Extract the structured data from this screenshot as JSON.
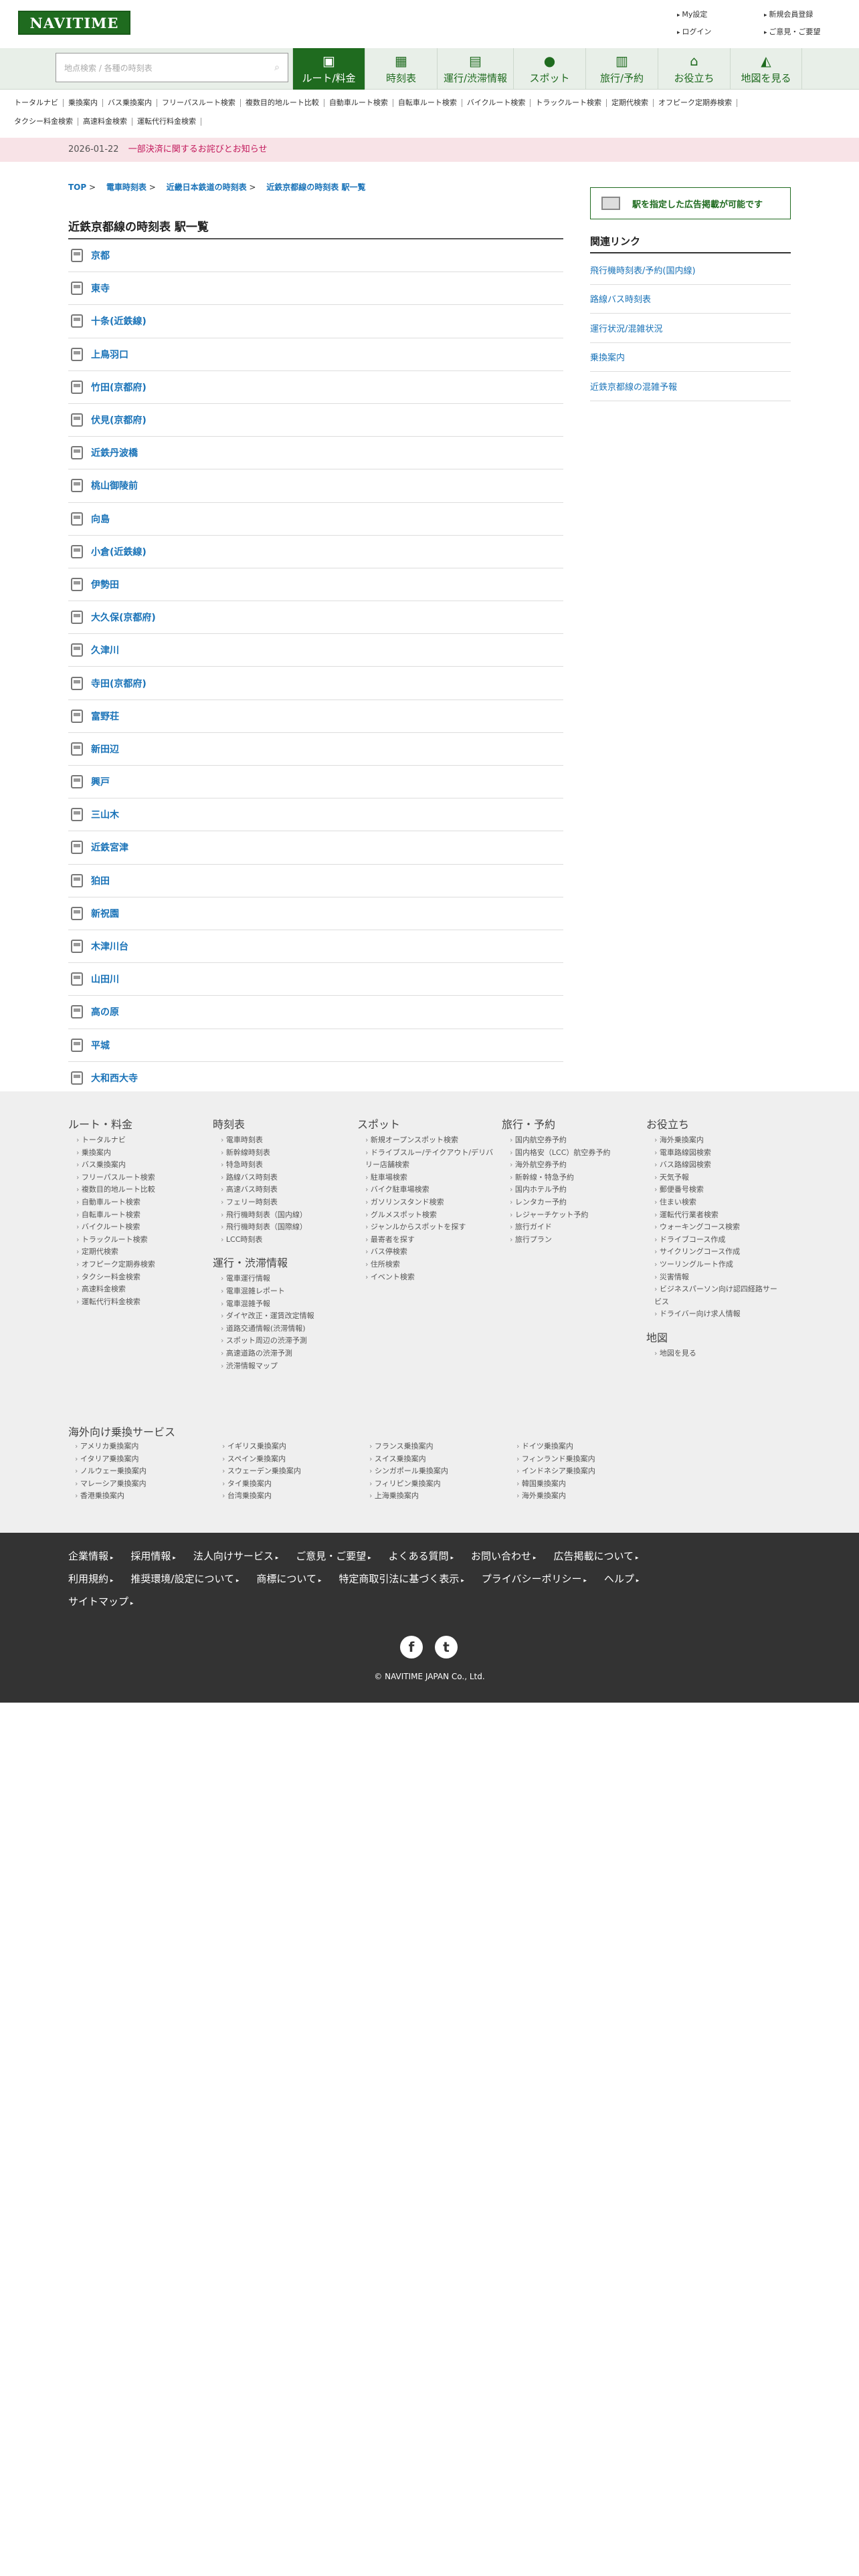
{
  "header": {
    "logo": "NAVITIME",
    "links": [
      "My設定",
      "新規会員登録",
      "ログイン",
      "ご意見・ご要望"
    ]
  },
  "search": {
    "placeholder": "地点検索 / 各種の時刻表"
  },
  "nav": [
    {
      "label": "ルート/料金",
      "icon": "package-icon"
    },
    {
      "label": "時刻表",
      "icon": "calendar-icon"
    },
    {
      "label": "運行/渋滞情報",
      "icon": "bus-train-icon"
    },
    {
      "label": "スポット",
      "icon": "map-pin-icon"
    },
    {
      "label": "旅行/予約",
      "icon": "luggage-icon"
    },
    {
      "label": "お役立ち",
      "icon": "house-icon"
    },
    {
      "label": "地図を見る",
      "icon": "map-icon"
    }
  ],
  "subnav": [
    "トータルナビ",
    "乗換案内",
    "バス乗換案内",
    "フリーパスルート検索",
    "複数目的地ルート比較",
    "自動車ルート検索",
    "自転車ルート検索",
    "バイクルート検索",
    "トラックルート検索",
    "定期代検索",
    "オフピーク定期券検索",
    "タクシー料金検索",
    "高速料金検索",
    "運転代行料金検索"
  ],
  "notice": {
    "date": "2026-01-22",
    "text": "一部決済に関するお詫びとお知らせ"
  },
  "breadcrumb": [
    "TOP",
    "電車時刻表",
    "近畿日本鉄道の時刻表",
    "近鉄京都線の時刻表 駅一覧"
  ],
  "page_title": "近鉄京都線の時刻表 駅一覧",
  "stations": [
    "京都",
    "東寺",
    "十条(近鉄線)",
    "上鳥羽口",
    "竹田(京都府)",
    "伏見(京都府)",
    "近鉄丹波橋",
    "桃山御陵前",
    "向島",
    "小倉(近鉄線)",
    "伊勢田",
    "大久保(京都府)",
    "久津川",
    "寺田(京都府)",
    "富野荘",
    "新田辺",
    "興戸",
    "三山木",
    "近鉄宮津",
    "狛田",
    "新祝園",
    "木津川台",
    "山田川",
    "高の原",
    "平城",
    "大和西大寺"
  ],
  "sidebar": {
    "ad_label": "駅を指定した広告掲載が可能です",
    "related_title": "関連リンク",
    "related": [
      "飛行機時刻表/予約(国内線)",
      "路線バス時刻表",
      "運行状況/混雑状況",
      "乗換案内",
      "近鉄京都線の混雑予報"
    ]
  },
  "footer_cols": [
    {
      "title": "ルート・料金",
      "items": [
        "トータルナビ",
        "乗換案内",
        "バス乗換案内",
        "フリーパスルート検索",
        "複数目的地ルート比較",
        "自動車ルート検索",
        "自転車ルート検索",
        "バイクルート検索",
        "トラックルート検索",
        "定期代検索",
        "オフピーク定期券検索",
        "タクシー料金検索",
        "高速料金検索",
        "運転代行料金検索"
      ]
    },
    {
      "title": "時刻表",
      "items": [
        "電車時刻表",
        "新幹線時刻表",
        "特急時刻表",
        "路線バス時刻表",
        "高速バス時刻表",
        "フェリー時刻表",
        "飛行機時刻表（国内線）",
        "飛行機時刻表（国際線）",
        "LCC時刻表"
      ],
      "title2": "運行・渋滞情報",
      "items2": [
        "電車運行情報",
        "電車混雑レポート",
        "電車混雑予報",
        "ダイヤ改正・運賃改定情報",
        "道路交通情報(渋滞情報)",
        "スポット周辺の渋滞予測",
        "高速道路の渋滞予測",
        "渋滞情報マップ"
      ]
    },
    {
      "title": "スポット",
      "items": [
        "新規オープンスポット検索",
        "ドライブスルー/テイクアウト/デリバリー店舗検索",
        "駐車場検索",
        "バイク駐車場検索",
        "ガソリンスタンド検索",
        "グルメスポット検索",
        "ジャンルからスポットを探す",
        "最寄者を探す",
        "バス停検索",
        "住所検索",
        "イベント検索"
      ]
    },
    {
      "title": "旅行・予約",
      "items": [
        "国内航空券予約",
        "国内格安（LCC）航空券予約",
        "海外航空券予約",
        "新幹線・特急予約",
        "国内ホテル予約",
        "レンタカー予約",
        "レジャーチケット予約",
        "旅行ガイド",
        "旅行プラン"
      ]
    },
    {
      "title": "お役立ち",
      "items": [
        "海外乗換案内",
        "電車路線図検索",
        "バス路線図検索",
        "天気予報",
        "郵便番号検索",
        "住まい検索",
        "運転代行業者検索",
        "ウォーキングコース検索",
        "ドライブコース作成",
        "サイクリングコース作成",
        "ツーリングルート作成",
        "災害情報",
        "ビジネスパーソン向け認四経路サービス",
        "ドライバー向け求人情報"
      ],
      "title2": "地図",
      "items2": [
        "地図を見る"
      ]
    }
  ],
  "overseas": {
    "title": "海外向け乗換サービス",
    "items": [
      "アメリカ乗換案内",
      "イギリス乗換案内",
      "フランス乗換案内",
      "ドイツ乗換案内",
      "イタリア乗換案内",
      "スペイン乗換案内",
      "スイス乗換案内",
      "フィンランド乗換案内",
      "ノルウェー乗換案内",
      "スウェーデン乗換案内",
      "シンガポール乗換案内",
      "インドネシア乗換案内",
      "マレーシア乗換案内",
      "タイ乗換案内",
      "フィリピン乗換案内",
      "韓国乗換案内",
      "香港乗換案内",
      "台湾乗換案内",
      "上海乗換案内",
      "海外乗換案内"
    ]
  },
  "footer_links": [
    "企業情報",
    "採用情報",
    "法人向けサービス",
    "ご意見・ご要望",
    "よくある質問",
    "お問い合わせ",
    "広告掲載について",
    "利用規約",
    "推奨環境/設定について",
    "商標について",
    "特定商取引法に基づく表示",
    "プライバシーポリシー",
    "ヘルプ",
    "サイトマップ"
  ],
  "copyright": "© NAVITIME JAPAN Co., Ltd."
}
